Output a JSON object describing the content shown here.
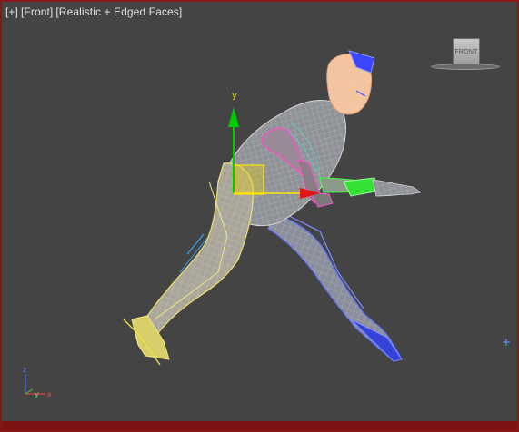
{
  "viewport": {
    "menu_plus": "[+]",
    "view_name": "[Front]",
    "shading_mode": "[Realistic + Edged Faces]"
  },
  "viewcube": {
    "face_label": "FRONT"
  },
  "gizmo": {
    "y_label": "y"
  },
  "triad": {
    "z": "z",
    "y": "y",
    "x": "x"
  },
  "colors": {
    "viewport_bg": "#444444",
    "active_border": "#8a1616",
    "mesh_wire": "#c9c9c9",
    "left_leg": "#f0e68c",
    "right_leg": "#5a6cff",
    "left_arm": "#ff4fc6",
    "right_hand": "#3cff3c",
    "head": "#f4c49e",
    "gizmo_y": "#00cc00",
    "gizmo_x": "#ff1a1a",
    "gizmo_plane": "#e5d200"
  },
  "icons": {
    "crosshair": "crosshair-icon",
    "viewcube": "viewcube-icon"
  }
}
